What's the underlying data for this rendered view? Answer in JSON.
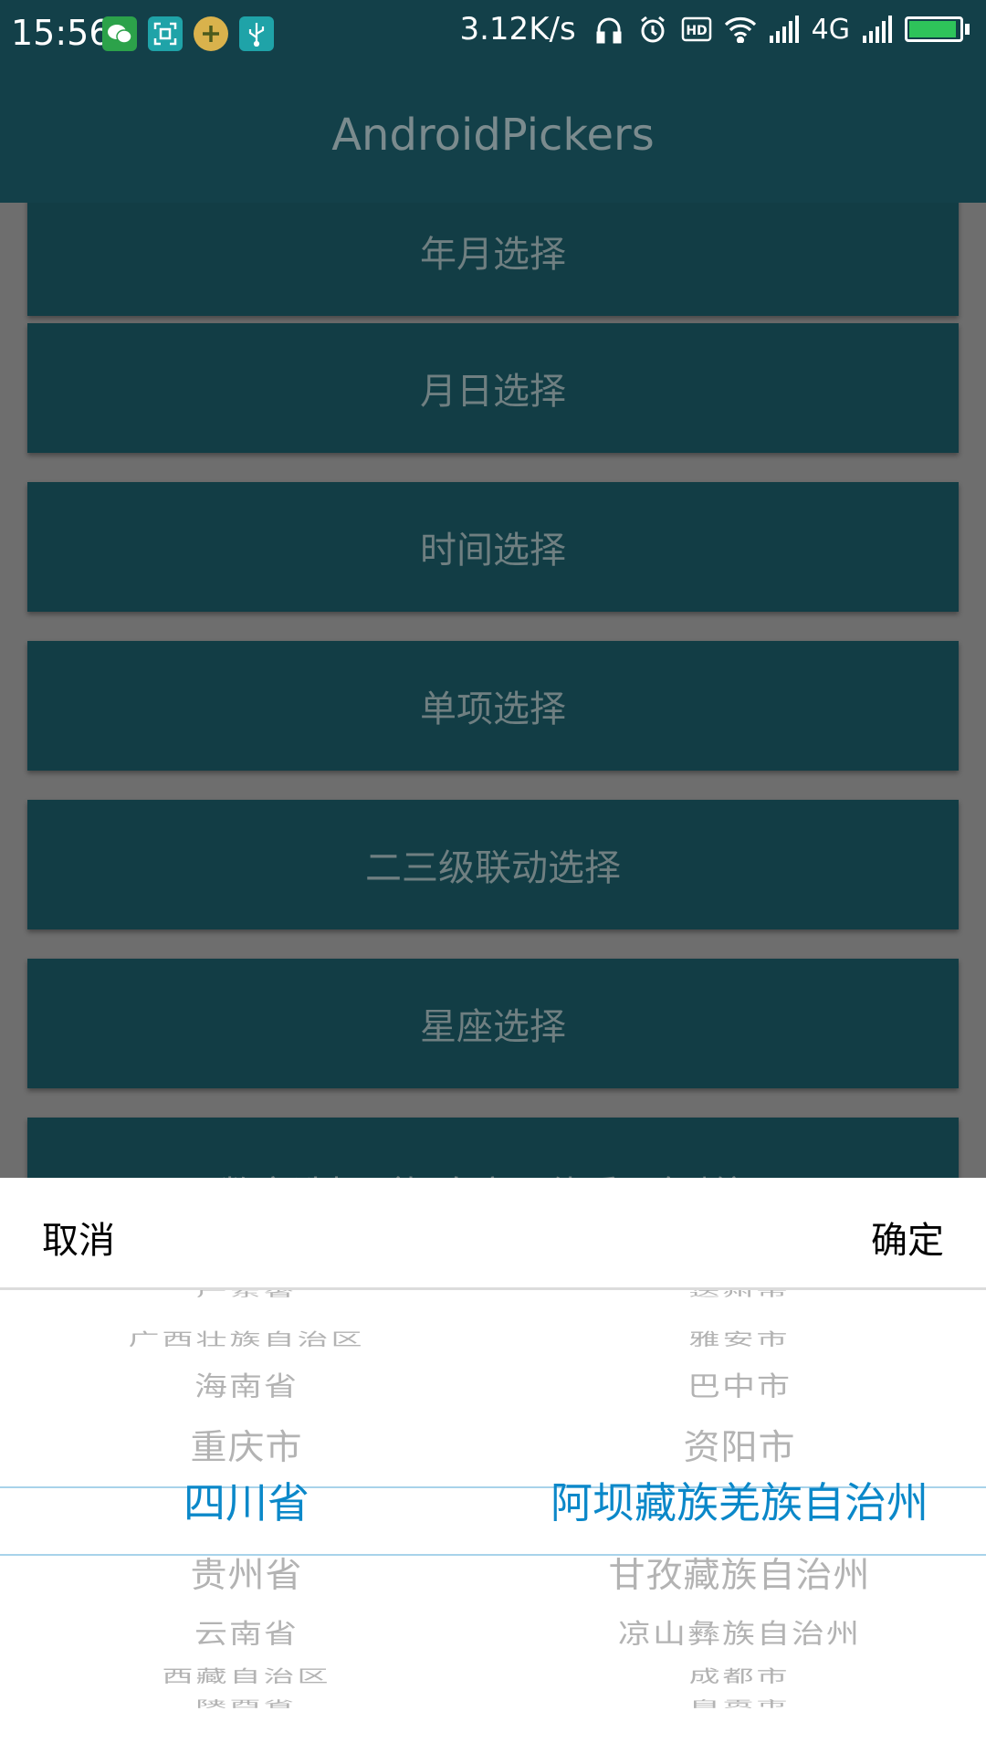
{
  "status_bar": {
    "time": "15:56",
    "speed": "3.12K/s",
    "network": "4G",
    "battery_level": 0.95,
    "icons": [
      "wechat-icon",
      "scan-icon",
      "plus-coin-icon",
      "usb-icon",
      "headphone-icon",
      "alarm-icon",
      "hd-icon",
      "wifi-icon",
      "signal-icon",
      "signal-icon-2",
      "battery-icon"
    ]
  },
  "app_bar": {
    "title": "AndroidPickers"
  },
  "options": [
    "年月选择",
    "月日选择",
    "时间选择",
    "单项选择",
    "二三级联动选择",
    "星座选择",
    "数字选择（如身高、体重、年龄）"
  ],
  "picker": {
    "cancel_label": "取消",
    "confirm_label": "确定",
    "province_items": [
      "广东省",
      "广西壮族自治区",
      "海南省",
      "重庆市",
      "四川省",
      "贵州省",
      "云南省",
      "西藏自治区",
      "陕西省"
    ],
    "city_items": [
      "达州市",
      "雅安市",
      "巴中市",
      "资阳市",
      "阿坝藏族羌族自治州",
      "甘孜藏族自治州",
      "凉山彝族自治州",
      "成都市",
      "自贡市"
    ],
    "selected_province": "四川省",
    "selected_city": "阿坝藏族羌族自治州"
  },
  "colors": {
    "primary": "#134049",
    "selected_text": "#0b88c9",
    "unselected_text": "#b3b3b3"
  }
}
